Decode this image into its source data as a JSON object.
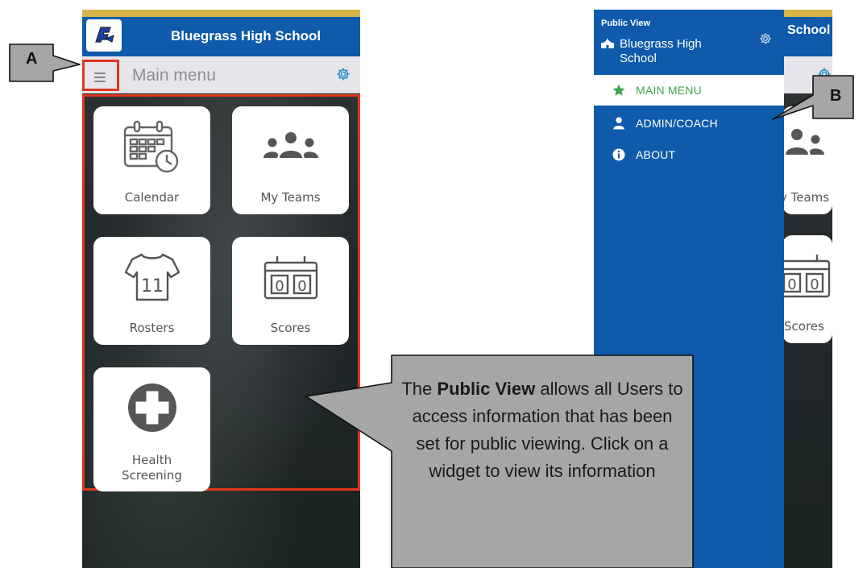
{
  "left_screen": {
    "header": {
      "title": "Bluegrass High School",
      "logo_icon": "school-logo"
    },
    "toolbar": {
      "title": "Main menu",
      "menu_icon": "hamburger-icon",
      "settings_icon": "gear-icon"
    },
    "tiles": [
      {
        "label": "Calendar",
        "icon": "calendar-icon"
      },
      {
        "label": "My Teams",
        "icon": "team-icon"
      },
      {
        "label": "Rosters",
        "icon": "jersey-icon",
        "jersey_number": "11"
      },
      {
        "label": "Scores",
        "icon": "scoreboard-icon",
        "score_left": "0",
        "score_right": "0"
      },
      {
        "label_line1": "Health",
        "label_line2": "Screening",
        "icon": "health-cross-icon"
      }
    ]
  },
  "right_screen": {
    "drawer": {
      "caption": "Public View",
      "school_line1": "Bluegrass High",
      "school_line2": "School",
      "items": [
        {
          "label": "MAIN MENU",
          "icon": "star-icon",
          "active": true
        },
        {
          "label": "ADMIN/COACH",
          "icon": "person-icon",
          "active": false
        },
        {
          "label": "ABOUT",
          "icon": "info-icon",
          "active": false
        }
      ]
    },
    "behind": {
      "header_fragment": "School",
      "teams_fragment": "y Teams",
      "scores_fragment": "Scores",
      "score_left": "0",
      "score_right": "0"
    }
  },
  "callouts": {
    "a": "A",
    "b": "B",
    "bubble": {
      "prefix": "The ",
      "bold": "Public View",
      "rest": " allows all Users to access information that has been set for public viewing. Click on a widget to view its information"
    }
  },
  "colors": {
    "brand_blue": "#0f5aab",
    "gold_strip": "#d8b54a",
    "highlight_red": "#e0361c",
    "active_green": "#3ea54e",
    "callout_gray": "#a6a6a6"
  }
}
